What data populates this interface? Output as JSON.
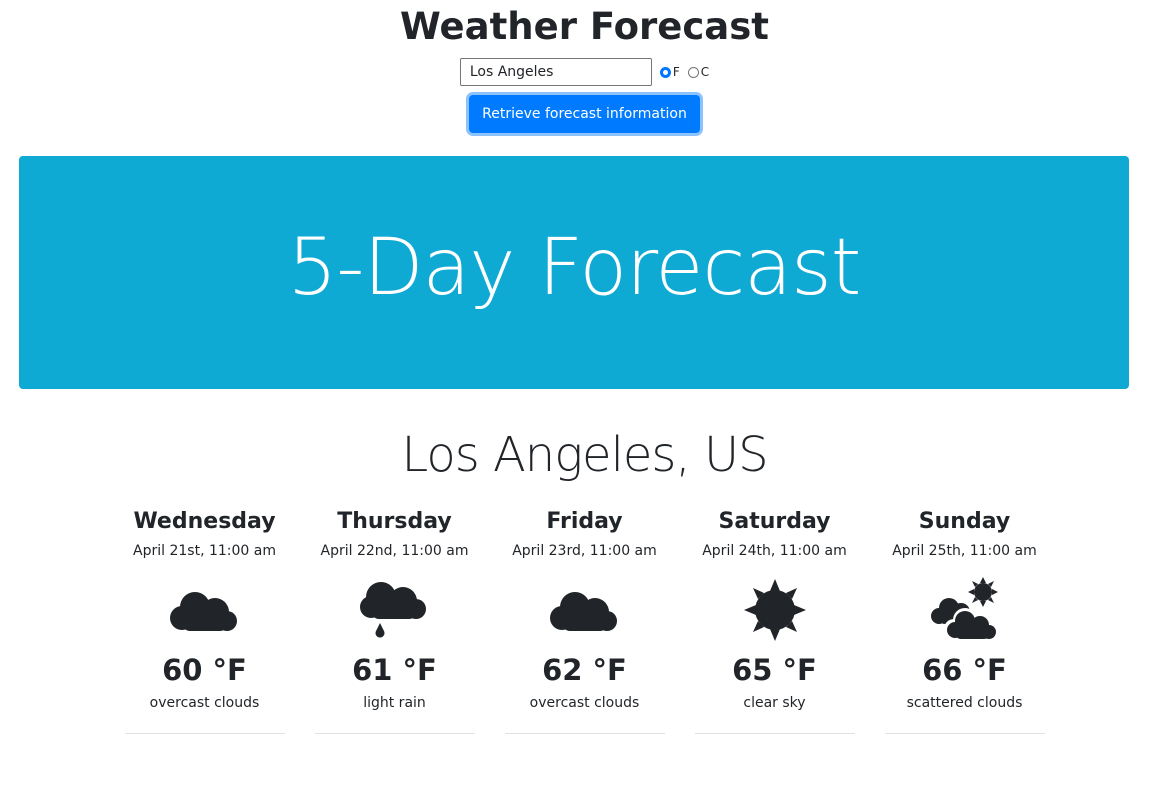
{
  "header": {
    "title": "Weather Forecast"
  },
  "search": {
    "value": "Los Angeles"
  },
  "units": {
    "f_label": "F",
    "c_label": "C",
    "selected": "F"
  },
  "button": {
    "label": "Retrieve forecast information"
  },
  "banner": {
    "title": "5-Day Forecast",
    "color": "#0eaad3"
  },
  "location": "Los Angeles, US",
  "days": [
    {
      "day": "Wednesday",
      "date": "April 21st, 11:00 am",
      "icon": "overcast-clouds-icon",
      "temp": "60 °F",
      "desc": "overcast clouds"
    },
    {
      "day": "Thursday",
      "date": "April 22nd, 11:00 am",
      "icon": "light-rain-icon",
      "temp": "61 °F",
      "desc": "light rain"
    },
    {
      "day": "Friday",
      "date": "April 23rd, 11:00 am",
      "icon": "overcast-clouds-icon",
      "temp": "62 °F",
      "desc": "overcast clouds"
    },
    {
      "day": "Saturday",
      "date": "April 24th, 11:00 am",
      "icon": "clear-sky-sun-icon",
      "temp": "65 °F",
      "desc": "clear sky"
    },
    {
      "day": "Sunday",
      "date": "April 25th, 11:00 am",
      "icon": "scattered-clouds-icon",
      "temp": "66 °F",
      "desc": "scattered clouds"
    }
  ]
}
